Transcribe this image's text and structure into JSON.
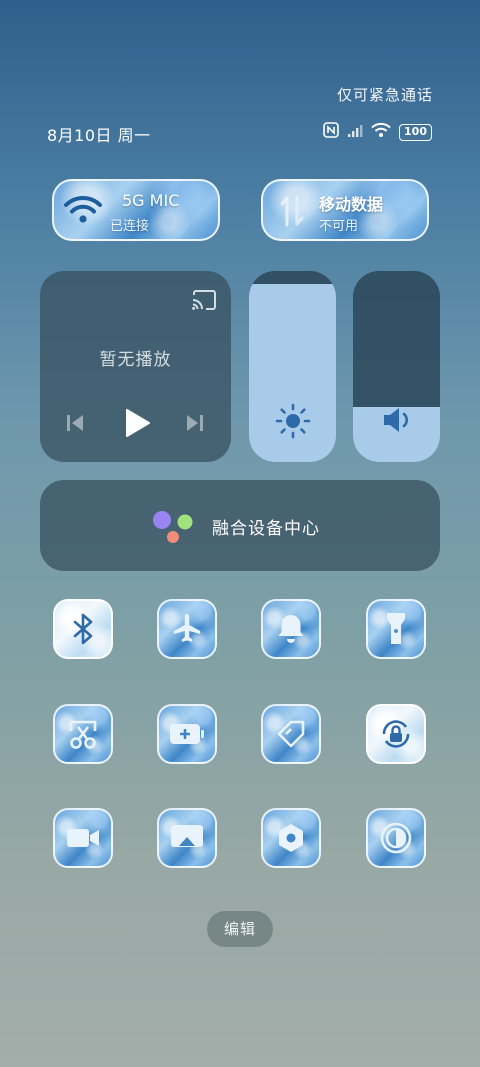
{
  "status": {
    "emergency_text": "仅可紧急通话",
    "date_text": "8月10日 周一",
    "battery_level": "100",
    "icons": [
      "nfc-icon",
      "signal-icon",
      "wifi-icon",
      "battery-icon"
    ]
  },
  "connectivity": {
    "wifi": {
      "title": "5G MIC",
      "subtitle": "已连接"
    },
    "mobile": {
      "title": "移动数据",
      "subtitle": "不可用"
    }
  },
  "media": {
    "status": "暂无播放",
    "icons": [
      "cast-icon",
      "previous-icon",
      "play-icon",
      "next-icon"
    ]
  },
  "sliders": {
    "brightness_level": 0.93,
    "volume_level": 0.29
  },
  "device_center": {
    "label": "融合设备中心"
  },
  "toggles": [
    {
      "name": "bluetooth",
      "icon": "bluetooth-icon",
      "active": true
    },
    {
      "name": "airplane",
      "icon": "airplane-icon",
      "active": false
    },
    {
      "name": "bell",
      "icon": "bell-icon",
      "active": false
    },
    {
      "name": "flashlight",
      "icon": "flashlight-icon",
      "active": false
    },
    {
      "name": "screenshot",
      "icon": "scissors-icon",
      "active": false
    },
    {
      "name": "battery-saver",
      "icon": "battery-plus-icon",
      "active": false
    },
    {
      "name": "location",
      "icon": "location-icon",
      "active": false
    },
    {
      "name": "rotation-lock",
      "icon": "rotation-lock-icon",
      "active": true
    },
    {
      "name": "screen-record",
      "icon": "video-icon",
      "active": false
    },
    {
      "name": "screen-cast",
      "icon": "screen-cast-icon",
      "active": false
    },
    {
      "name": "settings",
      "icon": "settings-icon",
      "active": false
    },
    {
      "name": "eye-comfort",
      "icon": "eye-comfort-icon",
      "active": false
    }
  ],
  "edit": {
    "label": "编辑"
  },
  "colors": {
    "accent_blue": "#2f6aa8",
    "slider_fill": "#a7cbe9",
    "panel": "#344e5c"
  }
}
